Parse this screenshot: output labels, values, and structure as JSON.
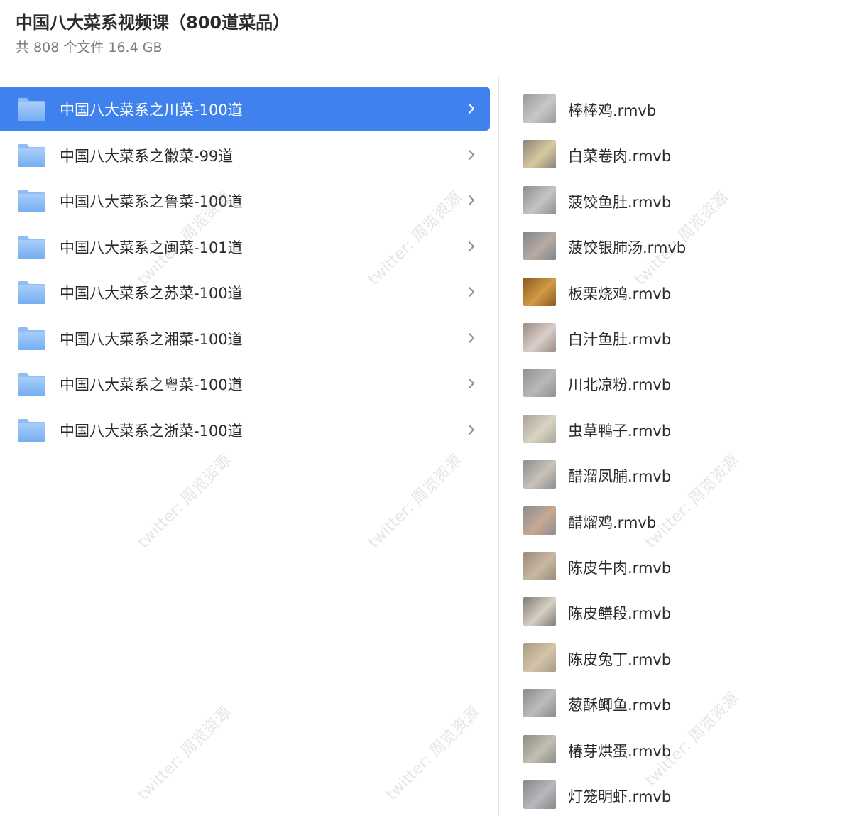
{
  "header": {
    "title": "中国八大菜系视频课（800道菜品）",
    "subtitle": "共 808 个文件 16.4 GB"
  },
  "folders": [
    {
      "label": "中国八大菜系之川菜-100道",
      "selected": true
    },
    {
      "label": "中国八大菜系之徽菜-99道",
      "selected": false
    },
    {
      "label": "中国八大菜系之鲁菜-100道",
      "selected": false
    },
    {
      "label": "中国八大菜系之闽菜-101道",
      "selected": false
    },
    {
      "label": "中国八大菜系之苏菜-100道",
      "selected": false
    },
    {
      "label": "中国八大菜系之湘菜-100道",
      "selected": false
    },
    {
      "label": "中国八大菜系之粤菜-100道",
      "selected": false
    },
    {
      "label": "中国八大菜系之浙菜-100道",
      "selected": false
    }
  ],
  "files": [
    {
      "label": "棒棒鸡.rmvb",
      "thumb_colors": [
        "#9a9a9c",
        "#c8c8ca"
      ]
    },
    {
      "label": "白菜卷肉.rmvb",
      "thumb_colors": [
        "#8a8478",
        "#d8c9a0"
      ]
    },
    {
      "label": "菠饺鱼肚.rmvb",
      "thumb_colors": [
        "#8e8e90",
        "#c4c4c6"
      ]
    },
    {
      "label": "菠饺银肺汤.rmvb",
      "thumb_colors": [
        "#7d8690",
        "#b9aaa0"
      ]
    },
    {
      "label": "板栗烧鸡.rmvb",
      "thumb_colors": [
        "#8a5a20",
        "#d19a45"
      ]
    },
    {
      "label": "白汁鱼肚.rmvb",
      "thumb_colors": [
        "#9c8c84",
        "#d8cfc8"
      ]
    },
    {
      "label": "川北凉粉.rmvb",
      "thumb_colors": [
        "#8f9090",
        "#b8b8b8"
      ]
    },
    {
      "label": "虫草鸭子.rmvb",
      "thumb_colors": [
        "#a8a49a",
        "#d9d3c2"
      ]
    },
    {
      "label": "醋溜凤脯.rmvb",
      "thumb_colors": [
        "#8c8e92",
        "#c9c2b8"
      ]
    },
    {
      "label": "醋熘鸡.rmvb",
      "thumb_colors": [
        "#8a8d94",
        "#c8a892"
      ]
    },
    {
      "label": "陈皮牛肉.rmvb",
      "thumb_colors": [
        "#9a8a7a",
        "#c8b8a2"
      ]
    },
    {
      "label": "陈皮鳝段.rmvb",
      "thumb_colors": [
        "#807c76",
        "#d6d0c4"
      ]
    },
    {
      "label": "陈皮兔丁.rmvb",
      "thumb_colors": [
        "#a89a86",
        "#d4c4a8"
      ]
    },
    {
      "label": "葱酥鲫鱼.rmvb",
      "thumb_colors": [
        "#8a8a8c",
        "#bcbcbe"
      ]
    },
    {
      "label": "椿芽烘蛋.rmvb",
      "thumb_colors": [
        "#8e8c84",
        "#c2c0b4"
      ]
    },
    {
      "label": "灯笼明虾.rmvb",
      "thumb_colors": [
        "#86888c",
        "#b6b8bc"
      ]
    }
  ],
  "watermark_text": "twitter: 周览资源"
}
